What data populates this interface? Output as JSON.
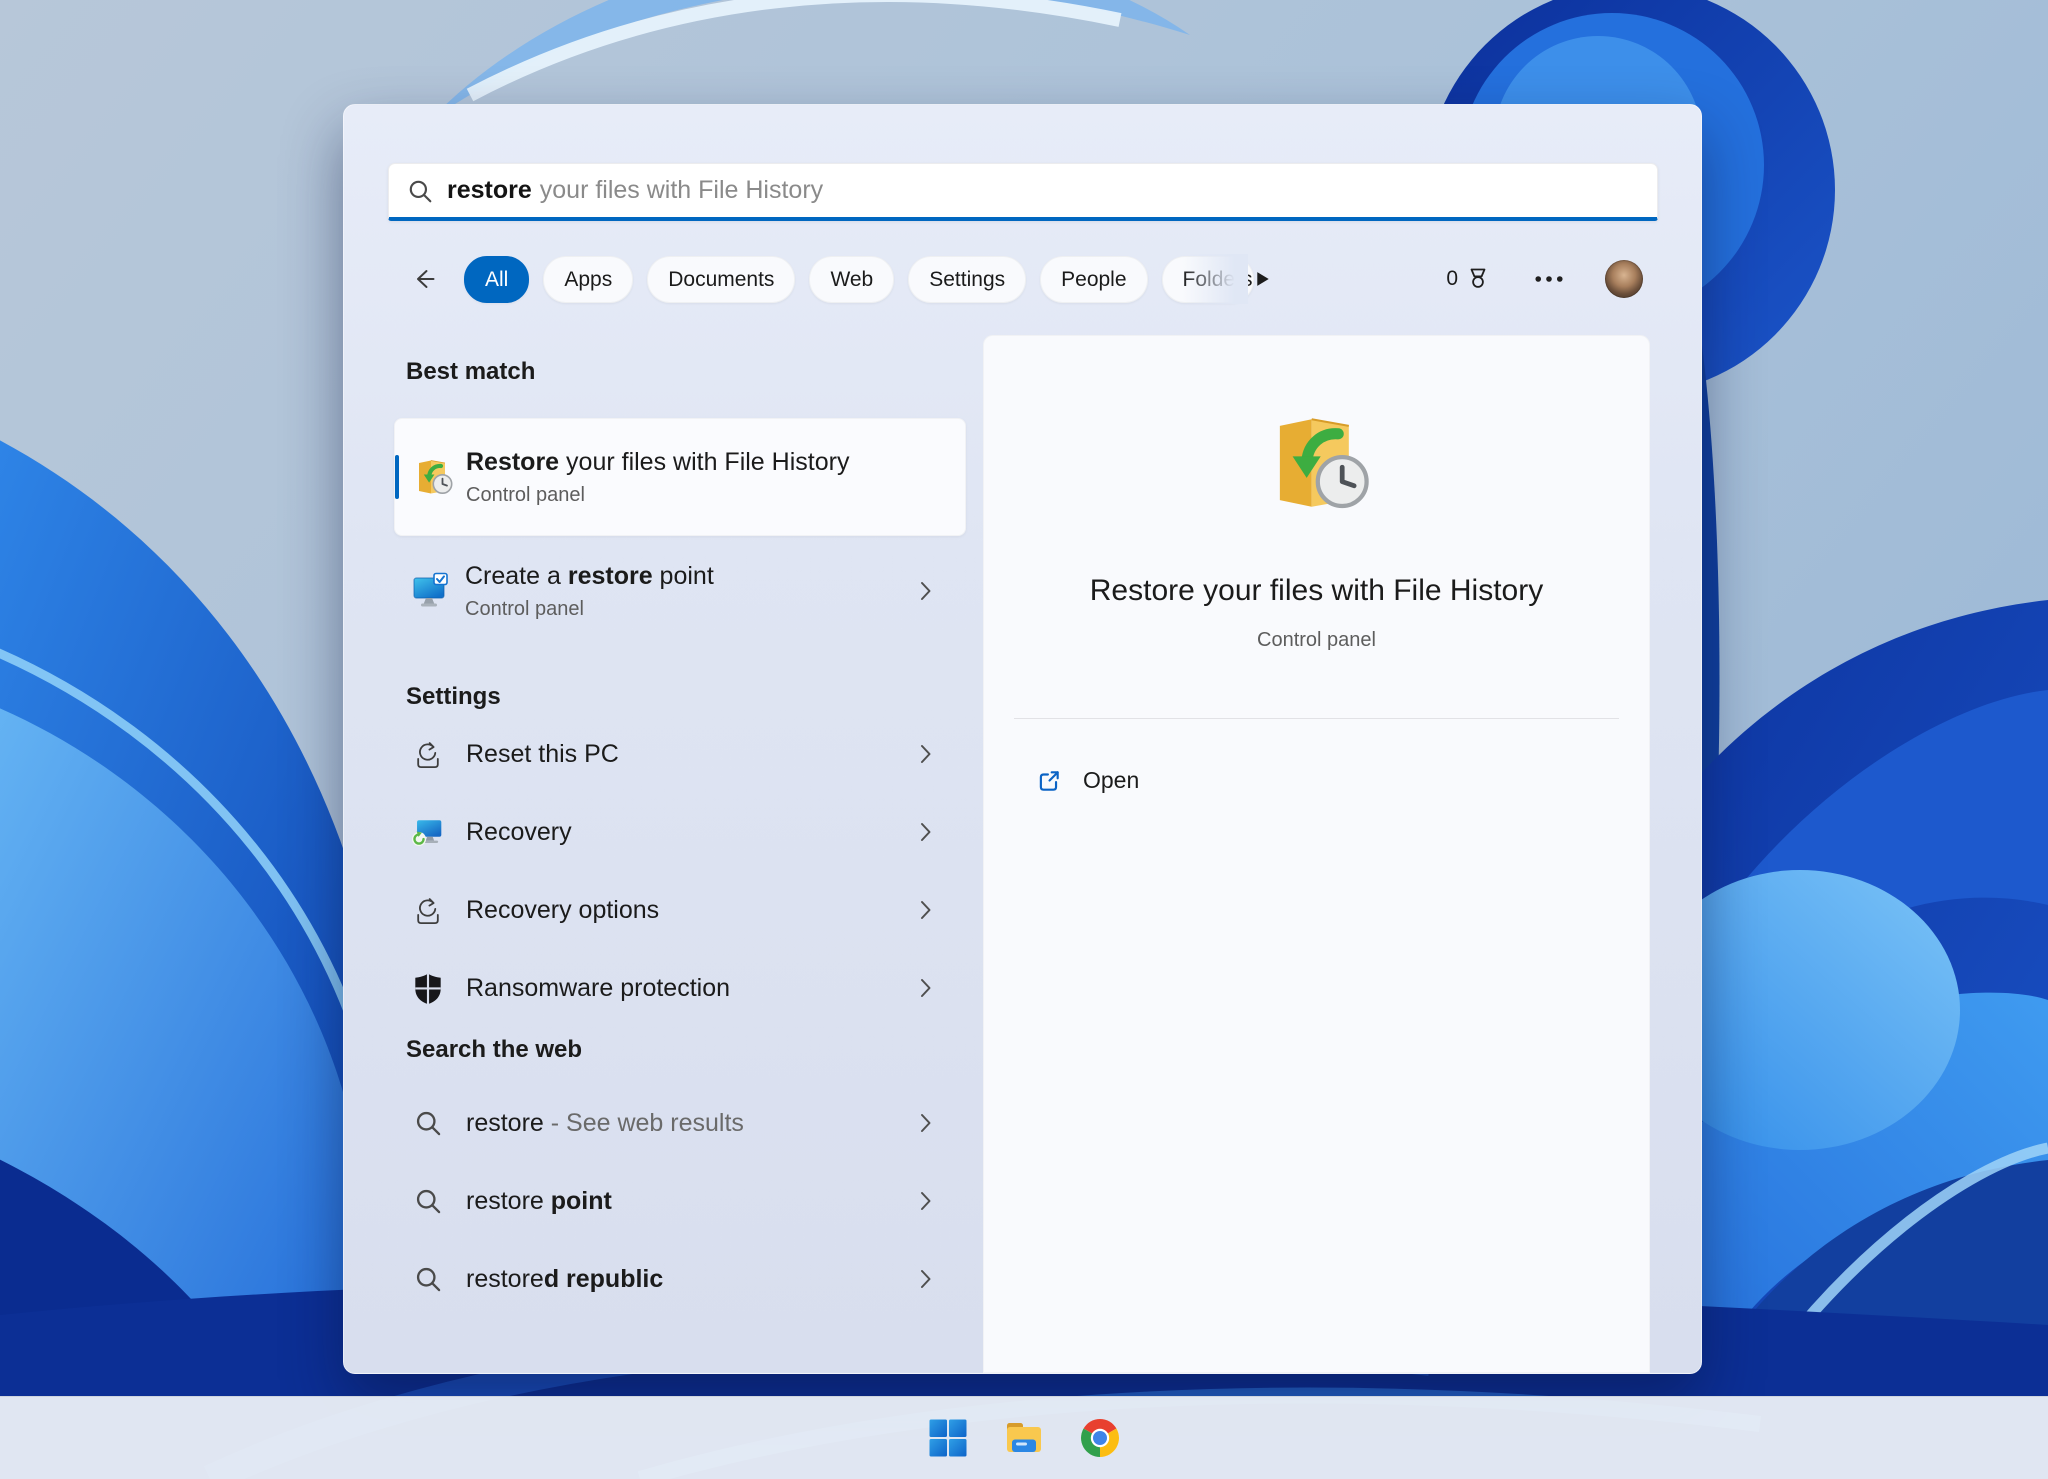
{
  "colors": {
    "accent": "#0067c0"
  },
  "search": {
    "typed": "restore",
    "suggestion": "your files with File History"
  },
  "filter_bar": {
    "tabs": [
      {
        "label": "All",
        "selected": true
      },
      {
        "label": "Apps"
      },
      {
        "label": "Documents"
      },
      {
        "label": "Web"
      },
      {
        "label": "Settings"
      },
      {
        "label": "People"
      },
      {
        "label": "Folders"
      }
    ],
    "rewards_count": "0"
  },
  "best_match": {
    "header": "Best match",
    "title_bold": "Restore",
    "title_rest": " your files with File History",
    "subtitle": "Control panel"
  },
  "create_restore": {
    "pre": "Create a ",
    "bold": "restore",
    "post": " point",
    "subtitle": "Control panel"
  },
  "settings_section": {
    "header": "Settings",
    "items": [
      "Reset this PC",
      "Recovery",
      "Recovery options",
      "Ransomware protection"
    ]
  },
  "web_section": {
    "header": "Search the web",
    "items": [
      {
        "pre": "restore",
        "dim": " - See web results"
      },
      {
        "pre": "restore ",
        "bold": "point"
      },
      {
        "pre": "restore",
        "bold": "d republic"
      }
    ]
  },
  "preview": {
    "title": "Restore your files with File History",
    "subtitle": "Control panel",
    "open_label": "Open"
  },
  "taskbar": {
    "icons": [
      "windows-start",
      "file-explorer",
      "chrome"
    ]
  }
}
